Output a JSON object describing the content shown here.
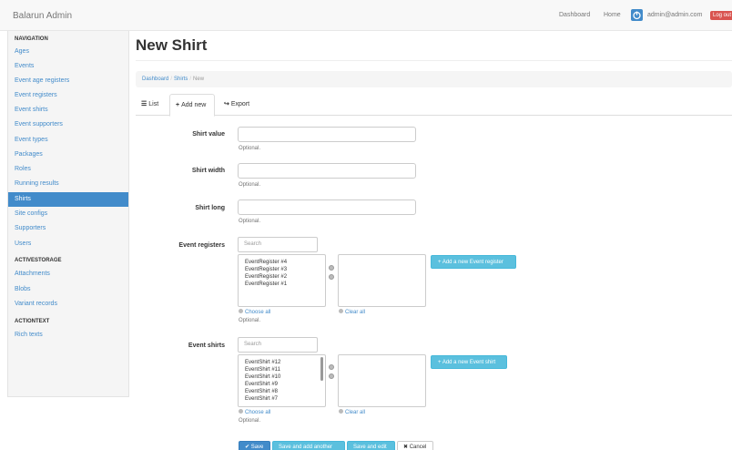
{
  "navbar": {
    "brand": "Balarun Admin",
    "links": {
      "dashboard": "Dashboard",
      "home": "Home"
    },
    "user_email": "admin@admin.com",
    "logout": "Log out"
  },
  "sidebar": {
    "sections": [
      {
        "header": "NAVIGATION"
      },
      {
        "header": "ACTIVESTORAGE"
      },
      {
        "header": "ACTIONTEXT"
      }
    ],
    "navigation_items": [
      "Ages",
      "Events",
      "Event age registers",
      "Event registers",
      "Event shirts",
      "Event supporters",
      "Event types",
      "Packages",
      "Roles",
      "Running results",
      "Shirts",
      "Site configs",
      "Supporters",
      "Users"
    ],
    "active_item": "Shirts",
    "activestorage_items": [
      "Attachments",
      "Blobs",
      "Variant records"
    ],
    "actiontext_items": [
      "Rich texts"
    ]
  },
  "page": {
    "title": "New Shirt",
    "breadcrumb": {
      "dashboard": "Dashboard",
      "shirts": "Shirts",
      "current": "New"
    },
    "tabs": {
      "list": "List",
      "add_new": "Add new",
      "export": "Export"
    }
  },
  "form": {
    "shirt_value": {
      "label": "Shirt value",
      "value": "",
      "help": "Optional."
    },
    "shirt_width": {
      "label": "Shirt width",
      "value": "",
      "help": "Optional."
    },
    "shirt_long": {
      "label": "Shirt long",
      "value": "",
      "help": "Optional."
    },
    "event_registers": {
      "label": "Event registers",
      "search_placeholder": "Search",
      "options": [
        "EventRegister #4",
        "EventRegister #3",
        "EventRegister #2",
        "EventRegister #1"
      ],
      "add_button": "+ Add a new Event register",
      "choose_all": "Choose all",
      "clear_all": "Clear all",
      "help": "Optional."
    },
    "event_shirts": {
      "label": "Event shirts",
      "search_placeholder": "Search",
      "options": [
        "EventShirt #12",
        "EventShirt #11",
        "EventShirt #10",
        "EventShirt #9",
        "EventShirt #8",
        "EventShirt #7"
      ],
      "add_button": "+ Add a new Event shirt",
      "choose_all": "Choose all",
      "clear_all": "Clear all",
      "help": "Optional."
    },
    "buttons": {
      "save": "✔ Save",
      "save_and_add_another": "Save and add another",
      "save_and_edit": "Save and edit",
      "cancel": "✖ Cancel"
    }
  },
  "colors": {
    "primary": "#428bca",
    "info": "#5bc0de",
    "danger": "#d9534f"
  },
  "icons": [
    "power-icon",
    "list-icon",
    "plus-icon",
    "share-icon",
    "check-icon",
    "times-icon"
  ]
}
